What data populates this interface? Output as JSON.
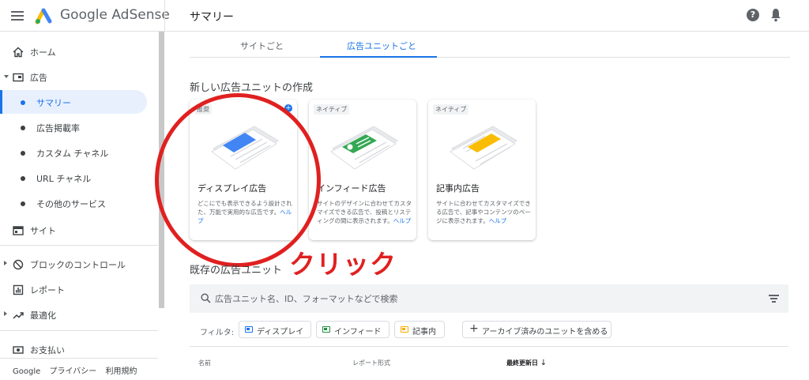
{
  "app": {
    "brand": "Google AdSense",
    "page_title": "サマリー"
  },
  "sidebar": {
    "items": [
      {
        "label": "ホーム",
        "icon": "home-icon"
      },
      {
        "label": "広告",
        "icon": "ads-icon"
      },
      {
        "label": "サマリー"
      },
      {
        "label": "広告掲載率"
      },
      {
        "label": "カスタム チャネル"
      },
      {
        "label": "URL チャネル"
      },
      {
        "label": "その他のサービス"
      },
      {
        "label": "サイト",
        "icon": "sites-icon"
      },
      {
        "label": "ブロックのコントロール",
        "icon": "block-icon"
      },
      {
        "label": "レポート",
        "icon": "reports-icon"
      },
      {
        "label": "最適化",
        "icon": "optimize-icon"
      },
      {
        "label": "お支払い",
        "icon": "payments-icon"
      }
    ],
    "footer": [
      "Google",
      "プライバシー",
      "利用規約"
    ]
  },
  "tabs": [
    {
      "label": "サイトごと"
    },
    {
      "label": "広告ユニットごと",
      "active": true
    }
  ],
  "create_section": {
    "title": "新しい広告ユニットの作成",
    "cards": [
      {
        "tag": "推奨",
        "name": "ディスプレイ広告",
        "desc": "どこにでも表示できるよう設計された、万能で実用的な広告です。",
        "help": "ヘルプ",
        "color": "#4285f4"
      },
      {
        "tag": "ネイティブ",
        "name": "インフィード広告",
        "desc": "サイトのデザインに合わせてカスタマイズできる広告で、投稿とリスティングの間に表示されます。",
        "help": "ヘルプ",
        "color": "#34a853"
      },
      {
        "tag": "ネイティブ",
        "name": "記事内広告",
        "desc": "サイトに合わせてカスタマイズできる広告で、記事やコンテンツのページに表示されます。",
        "help": "ヘルプ",
        "color": "#fbbc04"
      }
    ]
  },
  "annotation": {
    "text": "クリック",
    "color": "#e02020"
  },
  "existing_section": {
    "title": "既存の広告ユニット",
    "search_placeholder": "広告ユニット名、ID、フォーマットなどで検索",
    "filter_label": "フィルタ:",
    "chips": [
      {
        "label": "ディスプレイ",
        "color": "#1a73e8"
      },
      {
        "label": "インフィード",
        "color": "#1e8e3e"
      },
      {
        "label": "記事内",
        "color": "#f9ab00"
      }
    ],
    "archive_chip": "アーカイブ済みのユニットを含める",
    "columns": [
      "名前",
      "レポート形式",
      "最終更新日"
    ],
    "sort_indicator": "↓"
  }
}
